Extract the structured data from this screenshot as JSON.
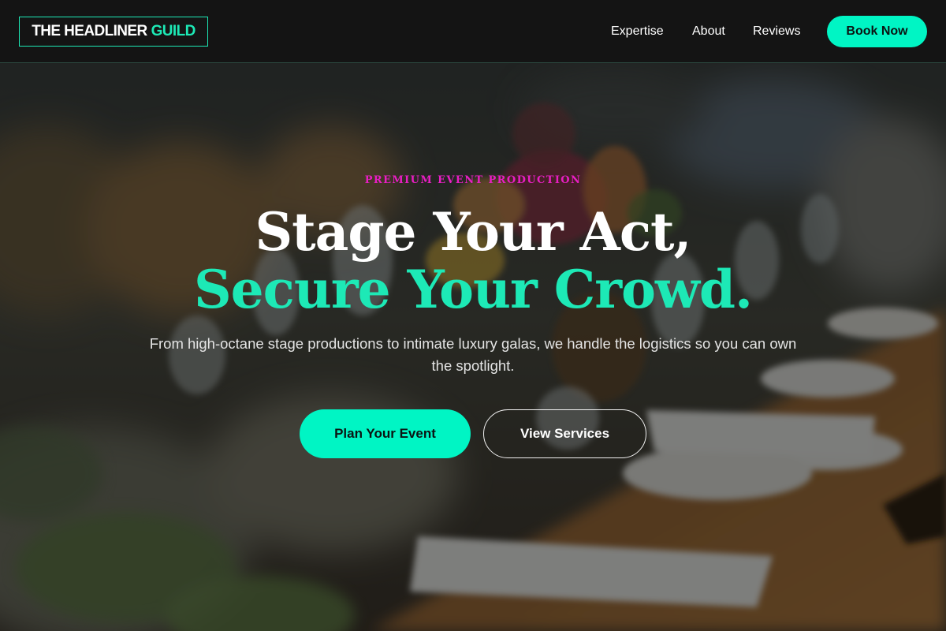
{
  "brand": {
    "name": "THE HEADLINER",
    "name_accent": "GUILD"
  },
  "nav": {
    "links": [
      {
        "label": "Expertise"
      },
      {
        "label": "About"
      },
      {
        "label": "Reviews"
      }
    ],
    "cta_label": "Book Now"
  },
  "hero": {
    "eyebrow": "PREMIUM EVENT PRODUCTION",
    "headline_line1": "Stage Your Act,",
    "headline_line2": "Secure Your Crowd.",
    "subtext": "From high-octane stage productions to intimate luxury galas, we handle the logistics so you can own the spotlight.",
    "primary_cta": "Plan Your Event",
    "secondary_cta": "View Services",
    "background_image": "blurred banquet table with wine glasses, plates and floral centerpiece"
  },
  "colors": {
    "accent": "#00f5c4",
    "accent_text": "#1de9b6",
    "eyebrow": "#e91ec4",
    "navbar_bg": "#141414"
  }
}
